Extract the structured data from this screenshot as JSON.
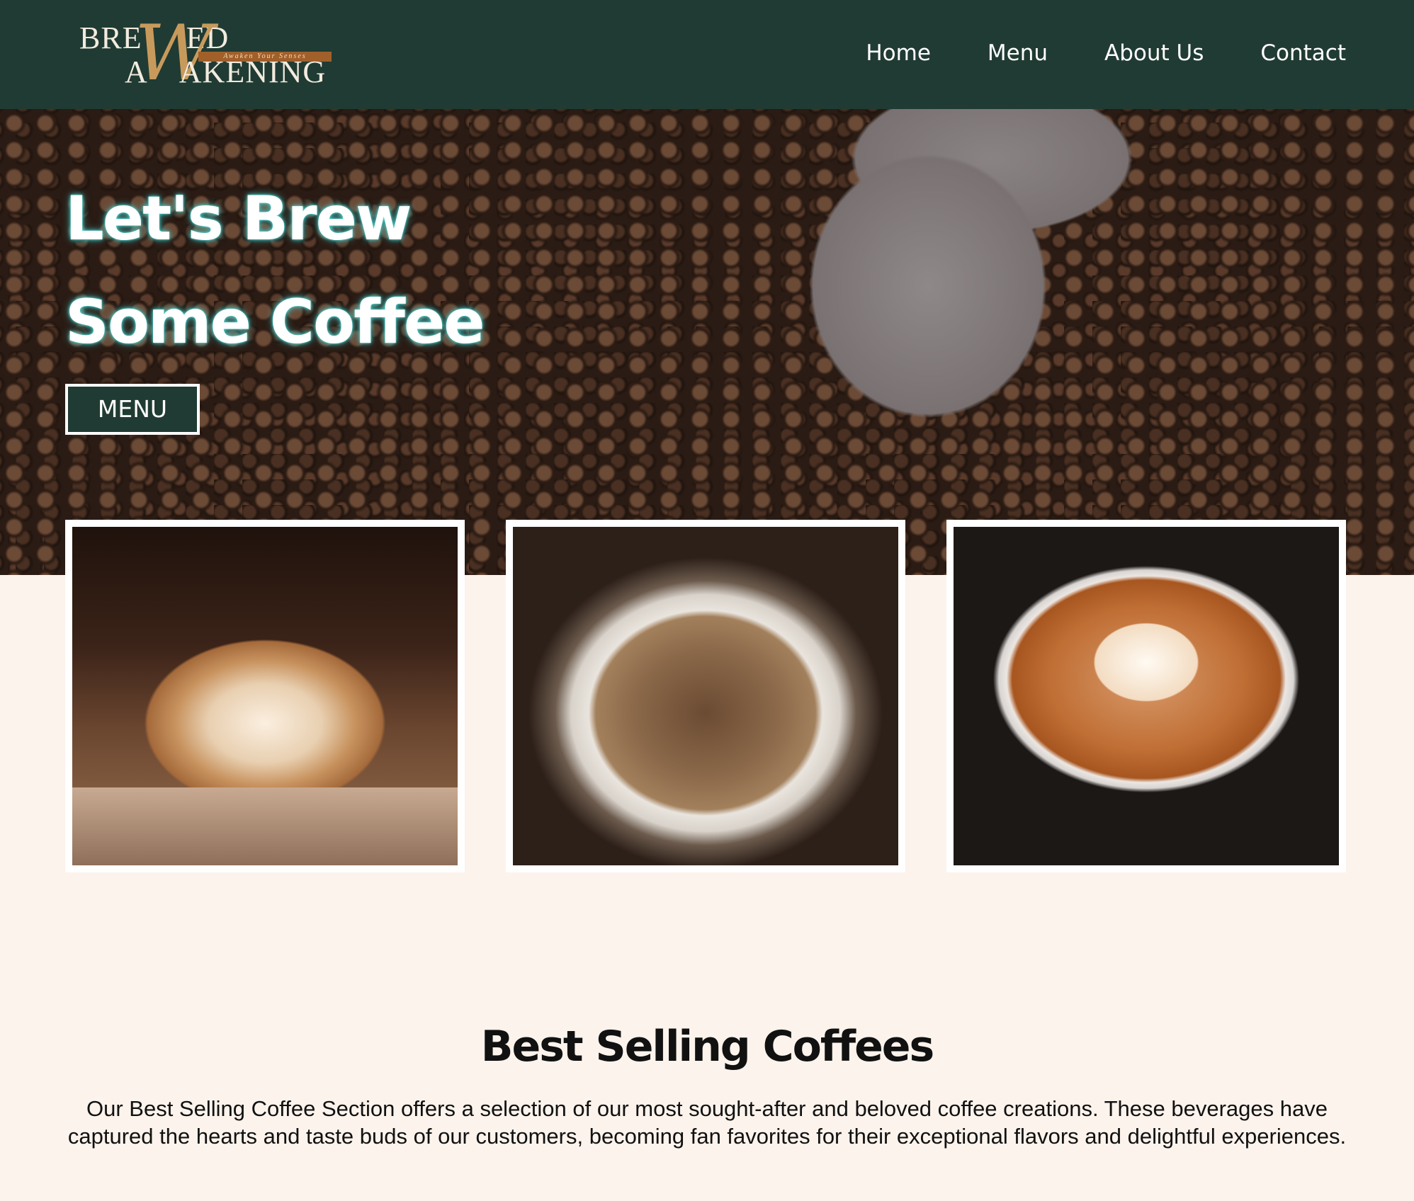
{
  "header": {
    "logo": {
      "line1": "BRE",
      "line1_end": "ED",
      "line2": "A",
      "line2_end": "AKENING",
      "monogram": "W",
      "tagline": "Awaken Your Senses"
    },
    "nav": [
      {
        "label": "Home"
      },
      {
        "label": "Menu"
      },
      {
        "label": "About Us"
      },
      {
        "label": "Contact"
      }
    ]
  },
  "hero": {
    "title": "Let's Brew Some Coffee",
    "button_label": "MENU"
  },
  "gallery": [
    {
      "alt": "Latte with leaf art"
    },
    {
      "alt": "Black coffee with crema"
    },
    {
      "alt": "Latte with heart art"
    }
  ],
  "best_selling": {
    "title": "Best Selling Coffees",
    "description": "Our Best Selling Coffee Section offers a selection of our most sought-after and beloved coffee creations. These beverages have captured the hearts and taste buds of our customers, becoming fan favorites for their exceptional flavors and delightful experiences."
  },
  "colors": {
    "header_bg": "#203b33",
    "page_bg": "#fbf3ec",
    "accent_gold": "#c79a5c",
    "accent_copper": "#a15f2a",
    "title_glow": "#49d2d0"
  }
}
